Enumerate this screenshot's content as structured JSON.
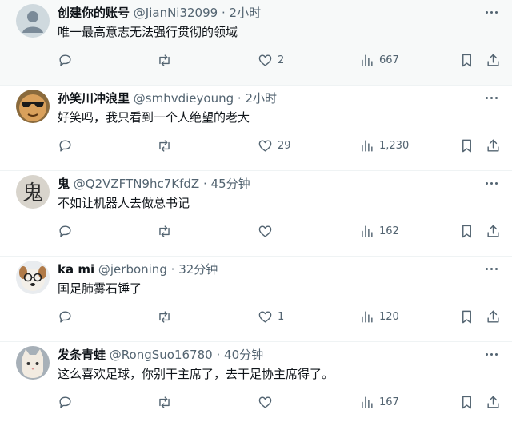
{
  "tweets": [
    {
      "name": "创建你的账号",
      "handle": "@JianNi32099",
      "separator": "·",
      "time": "2小时",
      "text": "唯一最高意志无法强行贯彻的领域",
      "replies": "",
      "retweets": "",
      "likes": "2",
      "views": "667",
      "avatar_icon": "default-profile-icon"
    },
    {
      "name": "孙笑川冲浪里",
      "handle": "@smhvdieyoung",
      "separator": "·",
      "time": "2小时",
      "text": "好笑吗，我只看到一个人绝望的老大",
      "replies": "",
      "retweets": "",
      "likes": "29",
      "views": "1,230",
      "avatar_icon": "sunglasses-face-avatar"
    },
    {
      "name": "鬼",
      "handle": "@Q2VZFTN9hc7KfdZ",
      "separator": "·",
      "time": "45分钟",
      "text": "不如让机器人去做总书记",
      "replies": "",
      "retweets": "",
      "likes": "",
      "views": "162",
      "avatar_icon": "ghost-character-avatar",
      "avatar_glyph": "鬼"
    },
    {
      "name": "ka mi",
      "handle": "@jerboning",
      "separator": "·",
      "time": "32分钟",
      "text": "国足肺雾石锤了",
      "replies": "",
      "retweets": "",
      "likes": "1",
      "views": "120",
      "avatar_icon": "dog-with-glasses-avatar"
    },
    {
      "name": "发条青蛙",
      "handle": "@RongSuo16780",
      "separator": "·",
      "time": "40分钟",
      "text": "这么喜欢足球，你别干主席了，去干足协主席得了。",
      "replies": "",
      "retweets": "",
      "likes": "",
      "views": "167",
      "avatar_icon": "cat-avatar"
    }
  ],
  "colors": {
    "text_primary": "#0f1419",
    "text_secondary": "#536471",
    "highlight_row": "#f7f9f9",
    "divider": "#eff3f4"
  }
}
